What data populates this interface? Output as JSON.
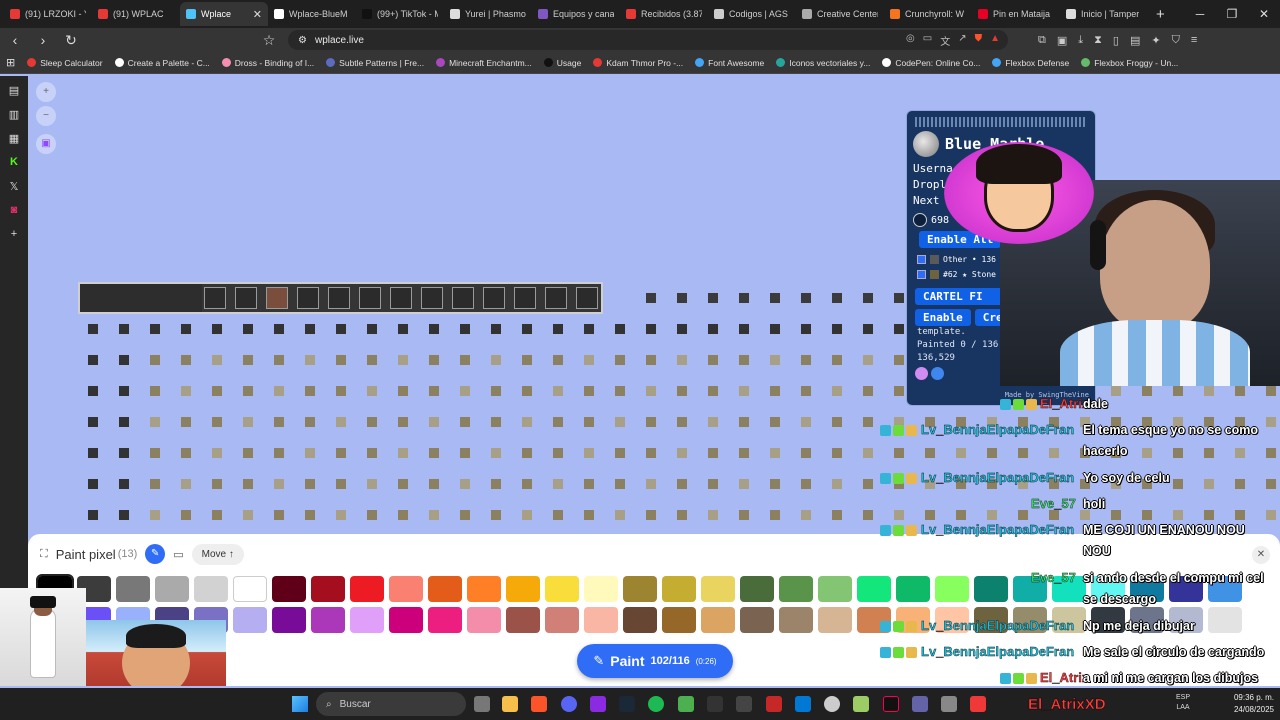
{
  "browser": {
    "tabs": [
      {
        "label": "(91) LRZOKI - Y",
        "color": "#e53935",
        "active": false
      },
      {
        "label": "(91) WPLAC",
        "color": "#e53935",
        "active": false
      },
      {
        "label": "Wplace",
        "color": "#4fc3f7",
        "active": true
      },
      {
        "label": "Wplace-BlueM",
        "color": "#ffffff",
        "active": false
      },
      {
        "label": "(99+) TikTok - M",
        "color": "#111111",
        "active": false
      },
      {
        "label": "Yurei | Phasmo",
        "color": "#dddddd",
        "active": false
      },
      {
        "label": "Equipos y cana",
        "color": "#7e57c2",
        "active": false
      },
      {
        "label": "Recibidos (3.87",
        "color": "#e53935",
        "active": false
      },
      {
        "label": "Codigos | AGS",
        "color": "#cccccc",
        "active": false
      },
      {
        "label": "Creative Center",
        "color": "#aaaaaa",
        "active": false
      },
      {
        "label": "Crunchyroll: W",
        "color": "#f47521",
        "active": false
      },
      {
        "label": "Pin en Mataija",
        "color": "#e60023",
        "active": false
      },
      {
        "label": "Inicio | Tamper",
        "color": "#dddddd",
        "active": false
      }
    ],
    "new_tab": "+",
    "url": "wplace.live",
    "bookmarks": [
      {
        "label": "Sleep Calculator",
        "color": "#e53935"
      },
      {
        "label": "Create a Palette - C...",
        "color": "#ffffff"
      },
      {
        "label": "Dross - Binding of I...",
        "color": "#f48fb1"
      },
      {
        "label": "Subtle Patterns | Fre...",
        "color": "#5c6bc0"
      },
      {
        "label": "Minecraft Enchantm...",
        "color": "#ab47bc"
      },
      {
        "label": "Usage",
        "color": "#111111"
      },
      {
        "label": "Kdam Thmor Pro -...",
        "color": "#e53935"
      },
      {
        "label": "Font Awesome",
        "color": "#42a5f5"
      },
      {
        "label": "Iconos vectoriales y...",
        "color": "#26a69a"
      },
      {
        "label": "CodePen: Online Co...",
        "color": "#ffffff"
      },
      {
        "label": "Flexbox Defense",
        "color": "#42a5f5"
      },
      {
        "label": "Flexbox Froggy - Un...",
        "color": "#66bb6a"
      }
    ]
  },
  "paint_panel": {
    "title": "Paint pixel",
    "count": "(13)",
    "move_label": "Move ↑",
    "close": "✕",
    "palette_row1": [
      "#000000",
      "#3c3c3c",
      "#787878",
      "#aaaaaa",
      "#d2d2d2",
      "#ffffff",
      "#600018",
      "#a50e1e",
      "#ed1c24",
      "#fa8072",
      "#e45c1a",
      "#ff7f27",
      "#f6aa09",
      "#f9dd3b",
      "#fffabc",
      "#9c8431",
      "#c5ad31",
      "#e8d45f",
      "#4a6b3a",
      "#5a944a",
      "#84c573",
      "#13e67b",
      "#0eb968",
      "#87ff5e",
      "#0c816e",
      "#10aea6",
      "#13e1be",
      "#60f7f2",
      "#0f799f",
      "#333399",
      "#4093e4"
    ],
    "palette_row2": [
      "#28509e",
      "#6b50f6",
      "#99b1fb",
      "#4a4284",
      "#7a71c4",
      "#b5aef1",
      "#780c99",
      "#aa38b9",
      "#e09ff9",
      "#cb007a",
      "#ec1f80",
      "#f38da9",
      "#9b5249",
      "#d18078",
      "#fab6a4",
      "#684634",
      "#95682a",
      "#dba463",
      "#7b6352",
      "#9c846b",
      "#d6b594",
      "#d18051",
      "#f8b277",
      "#ffc5a5",
      "#6d643f",
      "#948c6b",
      "#cdc59e",
      "#333941",
      "#6d758d",
      "#b3b9d1",
      "#e3e3e3"
    ],
    "paint_label": "Paint",
    "paint_charges": "102/116",
    "paint_timer": "(0:26)"
  },
  "blue_marble": {
    "title": "Blue Marble",
    "username_label": "Userna",
    "droplets_label": "Drople",
    "next_label": "Next",
    "coord_value": "698",
    "enable_all": "Enable All",
    "checks": [
      {
        "label": "Other • 136",
        "color": "#5a5a5a"
      },
      {
        "label": "#62 ★ Stone",
        "color": "#6d643f"
      }
    ],
    "template_name": "CARTEL FI",
    "enable_btn": "Enable",
    "create_btn": "Crea",
    "template_text": "template.",
    "painted": "Painted 0 / 136",
    "total": "136,529",
    "credit": "Made by SwingTheVine"
  },
  "chat": [
    {
      "user": "El_Atrix",
      "user_color": "#ff3b3b",
      "text": [
        "dale"
      ]
    },
    {
      "user": "Lv_BennjaElpapaDeFran",
      "user_color": "#19c3e0",
      "text": [
        "El tema esque yo no se como",
        "hacerlo"
      ]
    },
    {
      "user": "Lv_BennjaElpapaDeFran",
      "user_color": "#19c3e0",
      "text": [
        "Yo soy de celu"
      ]
    },
    {
      "user": "Eve_57",
      "user_color": "#39e36b",
      "text": [
        "holi"
      ]
    },
    {
      "user": "Lv_BennjaElpapaDeFran",
      "user_color": "#19c3e0",
      "text": [
        "ME COJI UN ENANOU NOU",
        "NOU"
      ]
    },
    {
      "user": "Eve_57",
      "user_color": "#39e36b",
      "text": [
        "si ando desde el compu mi cel",
        "se descargo"
      ]
    },
    {
      "user": "Lv_BennjaElpapaDeFran",
      "user_color": "#19c3e0",
      "text": [
        "Np me deja dibujar"
      ]
    },
    {
      "user": "Lv_BennjaElpapaDeFran",
      "user_color": "#19c3e0",
      "text": [
        "Me sale el circulo de cargando"
      ]
    },
    {
      "user": "El_Atrix",
      "user_color": "#ff3b3b",
      "text": [
        "a mi ni me cargan los dibujos"
      ]
    }
  ],
  "taskbar": {
    "search": "Buscar",
    "lang_top": "ESP",
    "lang_bottom": "LAA",
    "time": "09:36 p. m.",
    "date": "24/08/2025",
    "watermark": "El_AtrixXD"
  }
}
